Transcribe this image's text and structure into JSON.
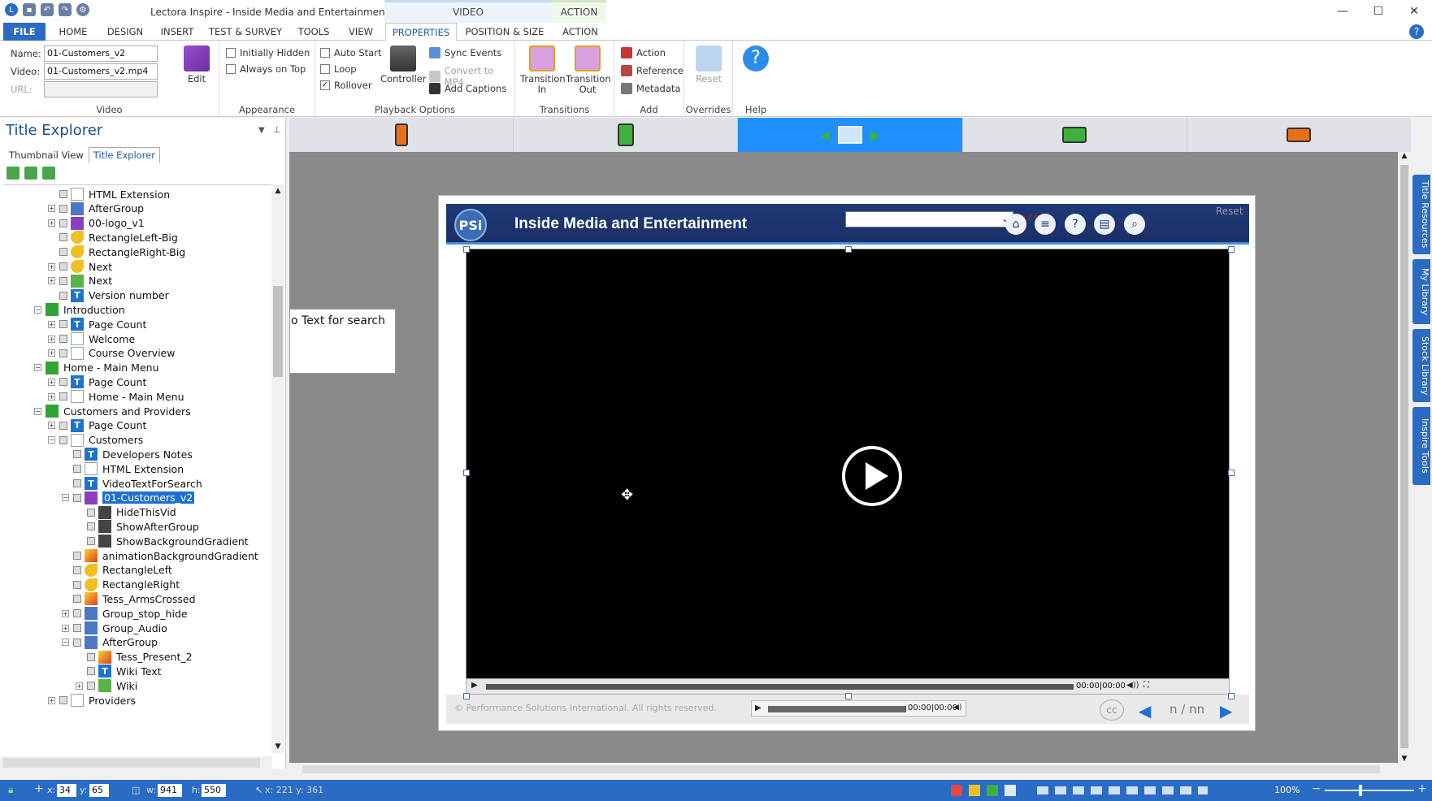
{
  "app": {
    "title": "Lectora Inspire - Inside Media and Entertainment",
    "context_groups": {
      "video": "VIDEO",
      "action": "ACTION"
    }
  },
  "tabs": [
    {
      "label": "FILE"
    },
    {
      "label": "HOME"
    },
    {
      "label": "DESIGN"
    },
    {
      "label": "INSERT"
    },
    {
      "label": "TEST & SURVEY"
    },
    {
      "label": "TOOLS"
    },
    {
      "label": "VIEW"
    },
    {
      "label": "PROPERTIES"
    },
    {
      "label": "POSITION & SIZE"
    },
    {
      "label": "ACTION"
    }
  ],
  "ribbon": {
    "video_group": {
      "name_label": "Name:",
      "name_value": "01-Customers_v2",
      "video_label": "Video:",
      "video_value": "01-Customers_v2.mp4",
      "url_label": "URL:",
      "url_value": "",
      "edit_label": "Edit",
      "group_label": "Video"
    },
    "appearance": {
      "initially_hidden": "Initially Hidden",
      "always_on_top": "Always on Top",
      "group_label": "Appearance"
    },
    "playback": {
      "auto_start": "Auto Start",
      "loop": "Loop",
      "rollover": "Rollover",
      "rollover_checked": true,
      "controller": "Controller",
      "sync_events": "Sync Events",
      "convert_mp4": "Convert to MP4",
      "add_captions": "Add Captions",
      "group_label": "Playback Options"
    },
    "transitions": {
      "in_1": "Transition",
      "in_2": "In",
      "out_1": "Transition",
      "out_2": "Out",
      "group_label": "Transitions"
    },
    "add": {
      "action": "Action",
      "reference": "Reference",
      "metadata": "Metadata",
      "group_label": "Add"
    },
    "overrides": {
      "reset": "Reset",
      "group_label": "Overrides"
    },
    "help": {
      "group_label": "Help"
    }
  },
  "explorer": {
    "title": "Title Explorer",
    "tabs": [
      "Thumbnail View",
      "Title Explorer"
    ],
    "tree": [
      {
        "label": "HTML Extension",
        "icon": "html"
      },
      {
        "label": "AfterGroup",
        "icon": "grp"
      },
      {
        "label": "00-logo_v1",
        "icon": "vid"
      },
      {
        "label": "RectangleLeft-Big",
        "icon": "shape"
      },
      {
        "label": "RectangleRight-Big",
        "icon": "shape"
      },
      {
        "label": "Next",
        "icon": "shape"
      },
      {
        "label": "Next",
        "icon": "wiki"
      },
      {
        "label": "Version number",
        "icon": "T"
      },
      {
        "label": "Introduction",
        "icon": "ch"
      },
      {
        "label": "Page Count",
        "icon": "T"
      },
      {
        "label": "Welcome",
        "icon": "pg"
      },
      {
        "label": "Course Overview",
        "icon": "pg"
      },
      {
        "label": "Home - Main Menu",
        "icon": "ch"
      },
      {
        "label": "Page Count",
        "icon": "T"
      },
      {
        "label": "Home - Main Menu",
        "icon": "pg"
      },
      {
        "label": "Customers and Providers",
        "icon": "ch"
      },
      {
        "label": "Page Count",
        "icon": "T"
      },
      {
        "label": "Customers",
        "icon": "pg"
      },
      {
        "label": "Developers Notes",
        "icon": "T"
      },
      {
        "label": "HTML Extension",
        "icon": "html"
      },
      {
        "label": "VideoTextForSearch",
        "icon": "T"
      },
      {
        "label": "01-Customers_v2",
        "icon": "vid"
      },
      {
        "label": "HideThisVid",
        "icon": "act"
      },
      {
        "label": "ShowAfterGroup",
        "icon": "act"
      },
      {
        "label": "ShowBackgroundGradient",
        "icon": "act"
      },
      {
        "label": "animationBackgroundGradient",
        "icon": "img"
      },
      {
        "label": "RectangleLeft",
        "icon": "shape"
      },
      {
        "label": "RectangleRight",
        "icon": "shape"
      },
      {
        "label": "Tess_ArmsCrossed",
        "icon": "img"
      },
      {
        "label": "Group_stop_hide",
        "icon": "grp"
      },
      {
        "label": "Group_Audio",
        "icon": "grp"
      },
      {
        "label": "AfterGroup",
        "icon": "grp"
      },
      {
        "label": "Tess_Present_2",
        "icon": "img"
      },
      {
        "label": "Wiki Text",
        "icon": "T"
      },
      {
        "label": "Wiki",
        "icon": "wiki"
      },
      {
        "label": "Providers",
        "icon": "pg"
      }
    ]
  },
  "course": {
    "title": "Inside Media and Entertainment",
    "logo": "PSi",
    "counter": "n / nn",
    "reset": "Reset",
    "copyright": "© Performance Solutions International. All rights reserved.",
    "cc": "cc",
    "page_number": "n  /  nn",
    "video_time": "00:00|00:00",
    "audio_time": "00:00|00:00",
    "search_text": "o Text for search"
  },
  "side_tabs": [
    "Title Resources",
    "My Library",
    "Stock Library",
    "Inspire Tools"
  ],
  "status": {
    "x_label": "x:",
    "x": "34",
    "y_label": "y:",
    "y": "65",
    "w_label": "w:",
    "w": "941",
    "h_label": "h:",
    "h": "550",
    "cursor": "x: 221  y: 361",
    "zoom": "100%"
  }
}
